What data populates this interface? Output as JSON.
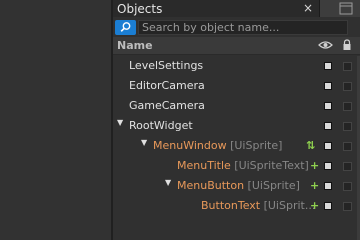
{
  "panel": {
    "title": "Objects",
    "close_glyph": "×",
    "menu_icon": "window-menu-icon"
  },
  "search": {
    "placeholder": "Search by object name...",
    "button_icon": "search-icon"
  },
  "header": {
    "name_label": "Name",
    "visibility_icon": "eye-icon",
    "lock_icon": "lock-icon"
  },
  "tree": [
    {
      "label": "LevelSettings",
      "type": "",
      "expand": "",
      "action": ""
    },
    {
      "label": "EditorCamera",
      "type": "",
      "expand": "",
      "action": ""
    },
    {
      "label": "GameCamera",
      "type": "",
      "expand": "",
      "action": ""
    },
    {
      "label": "RootWidget",
      "type": "",
      "expand": "▼",
      "action": ""
    },
    {
      "label": "MenuWindow",
      "type": " [UiSprite]",
      "expand": "▼",
      "action": "⇅"
    },
    {
      "label": "MenuTitle",
      "type": " [UiSpriteText]",
      "expand": "",
      "action": "+"
    },
    {
      "label": "MenuButton",
      "type": " [UiSprite]",
      "expand": "▼",
      "action": "+"
    },
    {
      "label": "ButtonText",
      "type": " [UiSprit...",
      "expand": "",
      "action": "+"
    }
  ],
  "colors": {
    "accent": "#1b7ed3",
    "ui_object": "#e8995a",
    "type_hint": "#878787",
    "add_icon": "#8fd14f"
  }
}
